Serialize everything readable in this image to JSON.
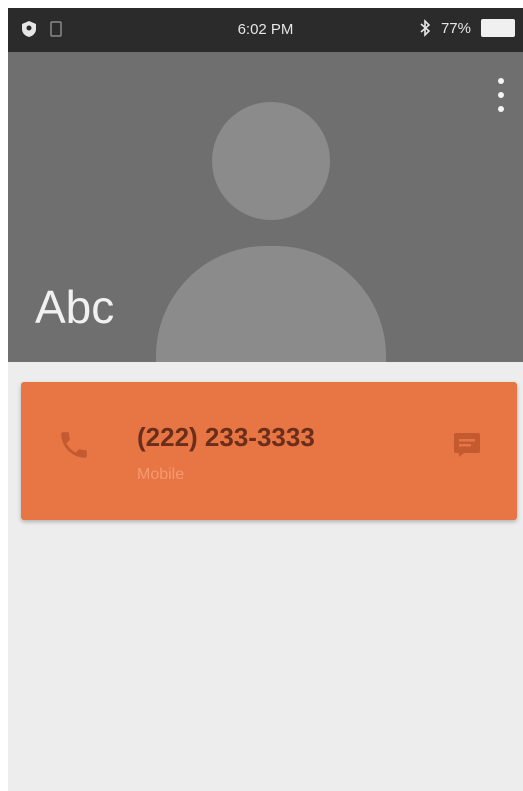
{
  "status_bar": {
    "time": "6:02 PM",
    "battery_percent": "77%",
    "icons": [
      "shield-icon",
      "sim-icon",
      "bluetooth-icon",
      "battery-icon"
    ]
  },
  "contact": {
    "name": "Abc",
    "phone": {
      "number": "(222) 233-3333",
      "type": "Mobile"
    }
  },
  "colors": {
    "header_bg": "#6f6f70",
    "card_accent": "#e87544",
    "page_bg": "#ededee"
  }
}
